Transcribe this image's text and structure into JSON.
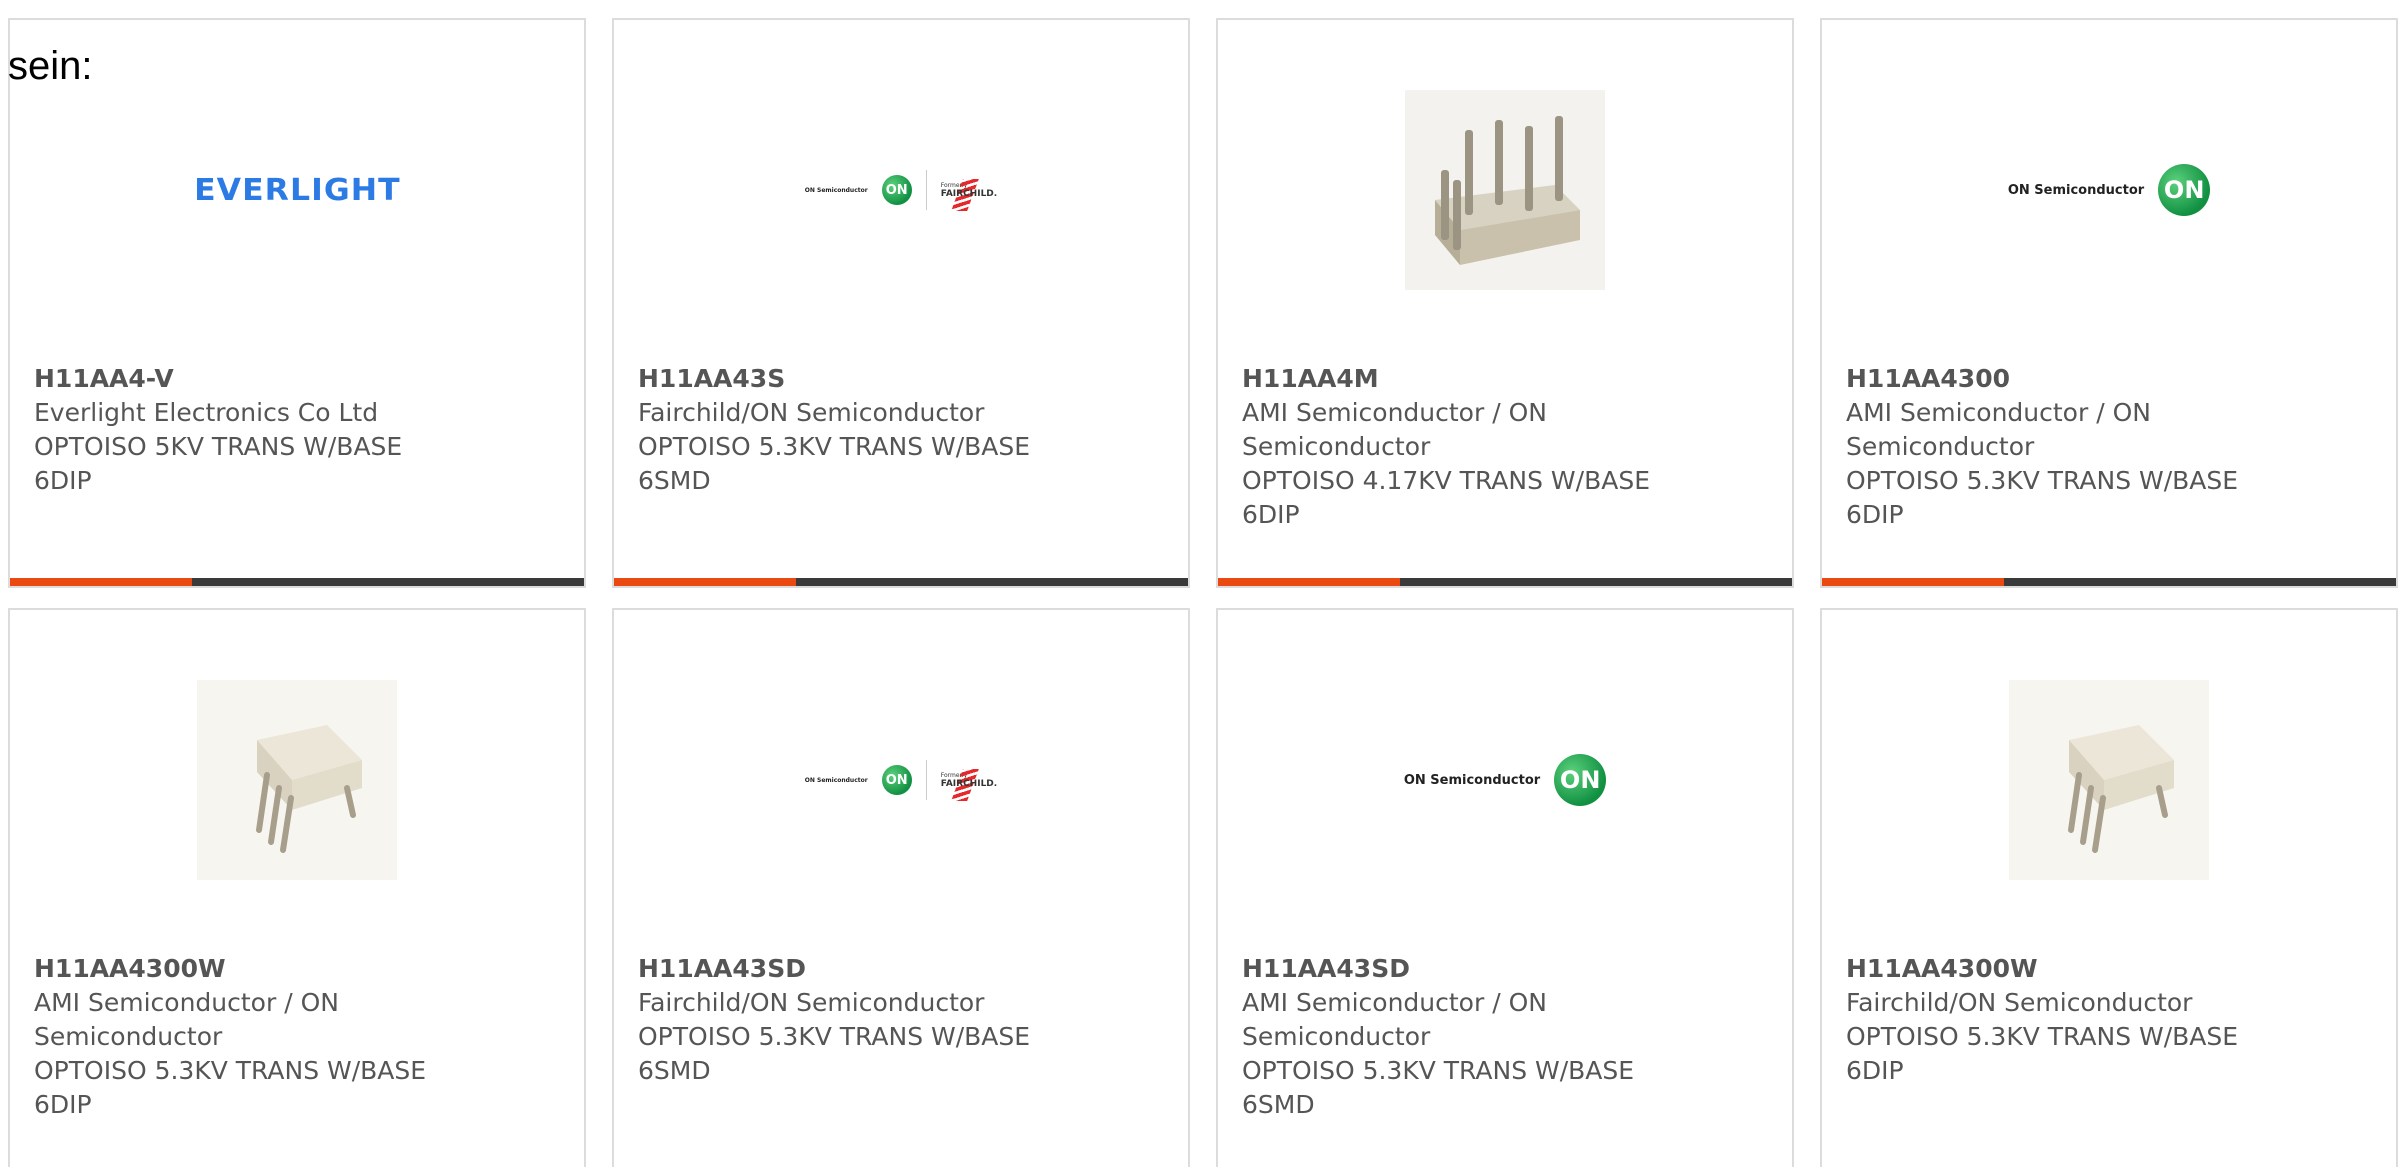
{
  "page": {
    "heading_fragment": "sein:"
  },
  "colors": {
    "accent": "#ea4a12",
    "bar": "#3a3a3a",
    "text": "#555555",
    "border": "#dcdcdc",
    "everlight_blue": "#2c7be5",
    "on_green": "#119042"
  },
  "cards": [
    {
      "part_number": "H11AA4-V",
      "manufacturer": "Everlight Electronics Co Ltd",
      "desc_line1": "OPTOISO 5KV TRANS W/BASE",
      "desc_line2": "6DIP",
      "image": "everlight-logo",
      "logo_text": "EVERLIGHT"
    },
    {
      "part_number": "H11AA43S",
      "manufacturer": "Fairchild/ON Semiconductor",
      "desc_line1": "OPTOISO 5.3KV TRANS W/BASE",
      "desc_line2": "6SMD",
      "image": "onsemi-fairchild-logo",
      "on_text": "ON Semiconductor",
      "on_mark": "ON",
      "formerly": "Formerly",
      "fairchild": "FAIRCHILD."
    },
    {
      "part_number": "H11AA4M",
      "manufacturer": "AMI Semiconductor / ON",
      "manufacturer_line2": "Semiconductor",
      "desc_line1": "OPTOISO 4.17KV TRANS W/BASE",
      "desc_line2": "6DIP",
      "image": "dip-package-photo"
    },
    {
      "part_number": "H11AA4300",
      "manufacturer": "AMI Semiconductor / ON",
      "manufacturer_line2": "Semiconductor",
      "desc_line1": "OPTOISO 5.3KV TRANS W/BASE",
      "desc_line2": "6DIP",
      "image": "onsemi-logo",
      "on_text": "ON Semiconductor",
      "on_mark": "ON"
    },
    {
      "part_number": "H11AA4300W",
      "manufacturer": "AMI Semiconductor / ON",
      "manufacturer_line2": "Semiconductor",
      "desc_line1": "OPTOISO 5.3KV TRANS W/BASE",
      "desc_line2": "6DIP",
      "image": "dip6-ic-photo"
    },
    {
      "part_number": "H11AA43SD",
      "manufacturer": "Fairchild/ON Semiconductor",
      "desc_line1": "OPTOISO 5.3KV TRANS W/BASE",
      "desc_line2": "6SMD",
      "image": "onsemi-fairchild-logo",
      "on_text": "ON Semiconductor",
      "on_mark": "ON",
      "formerly": "Formerly",
      "fairchild": "FAIRCHILD."
    },
    {
      "part_number": "H11AA43SD",
      "manufacturer": "AMI Semiconductor / ON",
      "manufacturer_line2": "Semiconductor",
      "desc_line1": "OPTOISO 5.3KV TRANS W/BASE",
      "desc_line2": "6SMD",
      "image": "onsemi-logo",
      "on_text": "ON Semiconductor",
      "on_mark": "ON"
    },
    {
      "part_number": "H11AA4300W",
      "manufacturer": "Fairchild/ON Semiconductor",
      "desc_line1": "OPTOISO 5.3KV TRANS W/BASE",
      "desc_line2": "6DIP",
      "image": "dip6-ic-photo"
    }
  ]
}
